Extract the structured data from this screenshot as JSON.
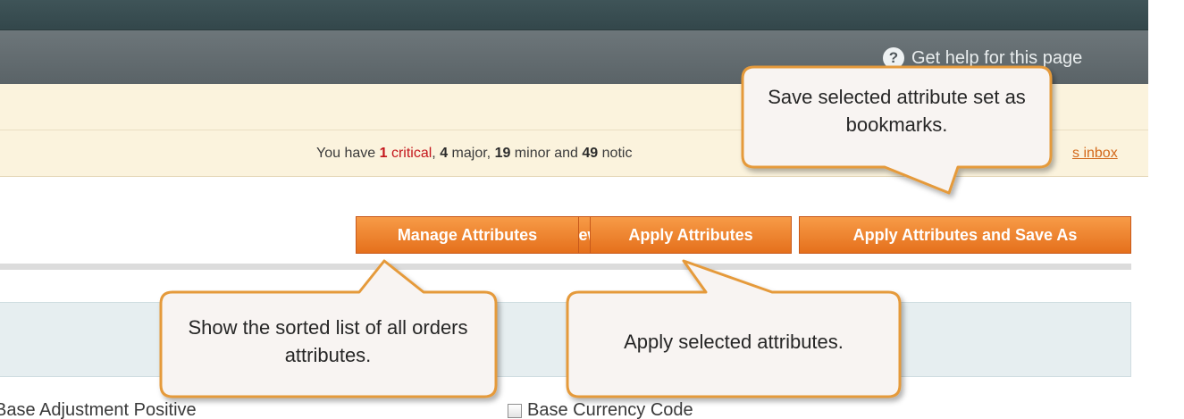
{
  "header": {
    "help_text": "Get help for this page",
    "help_icon": "question-circle-icon"
  },
  "messages": {
    "prefix": "You have ",
    "critical_count": "1",
    "critical_label": "critical",
    "sep1": ", ",
    "major_count": "4",
    "major_label": " major, ",
    "minor_count": "19",
    "minor_label": " minor and ",
    "notice_count": "49",
    "notice_label": " notic",
    "inbox_link": "s inbox"
  },
  "toolbar": {
    "create_order": "Create New Order",
    "manage_attributes": "Manage Attributes",
    "apply_attributes": "Apply Attributes",
    "apply_save_as": "Apply Attributes and Save As",
    "create_icon": "plus-circle-icon"
  },
  "callouts": {
    "save_bookmarks": "Save selected attribute set as bookmarks.",
    "sorted_list": "Show the sorted list of all orders attributes.",
    "apply_selected": "Apply selected attributes."
  },
  "attributes": {
    "left_label": "Base Adjustment Positive",
    "right_label": "Base Currency Code"
  },
  "colors": {
    "button_orange": "#e5701c",
    "critical_red": "#c4161c",
    "header_dark": "#33474b",
    "notice_bg": "#fbf3dd",
    "callout_fill": "#f8f4f2",
    "callout_border": "#e59a3a"
  }
}
